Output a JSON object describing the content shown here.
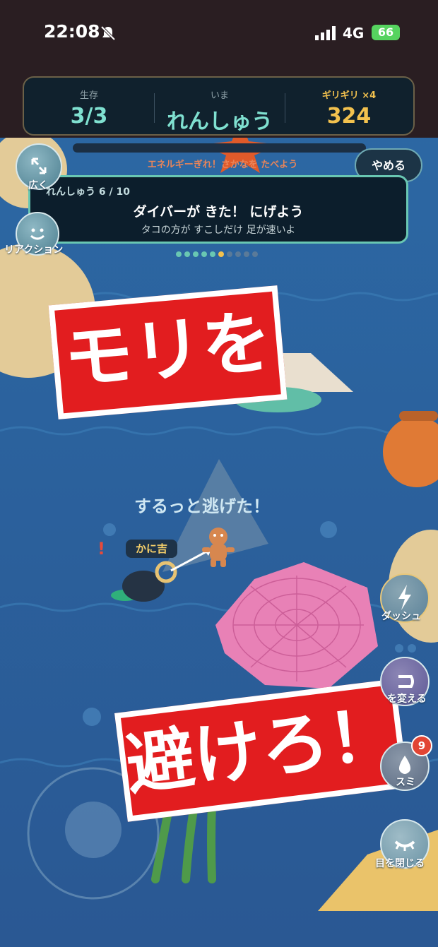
{
  "status_bar": {
    "time": "22:08",
    "network": "4G",
    "battery": "66"
  },
  "hud": {
    "alive_label": "生存",
    "alive_value": "3/3",
    "mode_label": "いま",
    "mode_value": "れんしゅう",
    "combo_label": "ギリギリ ×4",
    "combo_value": "324",
    "energy_text": "エネルギーぎれ！さかなを たべよう",
    "quit_label": "やめる"
  },
  "lesson": {
    "count": "れんしゅう 6 / 10",
    "title": "ダイバーが きた！ にげよう",
    "subtitle": "タコの方が すこしだけ 足が速いよ",
    "total_steps": 10,
    "current_step": 6
  },
  "left_buttons": {
    "zoom_label": "広く",
    "reaction_label": "リアクション"
  },
  "overlay_text": {
    "line1": "モリを",
    "line2": "避けろ！"
  },
  "game": {
    "escape_message": "するっと逃げた！",
    "player_name": "かに吉",
    "alert": "!"
  },
  "right_buttons": {
    "dash_label": "ダッシュ",
    "change_label": "を変える",
    "ink_label": "スミ",
    "ink_count": "9",
    "close_eyes_label": "目を閉じる"
  },
  "colors": {
    "accent_teal": "#69c7b2",
    "combo_gold": "#f2c14e",
    "banner_red": "#e21d1f",
    "water": "#2a5c95"
  }
}
